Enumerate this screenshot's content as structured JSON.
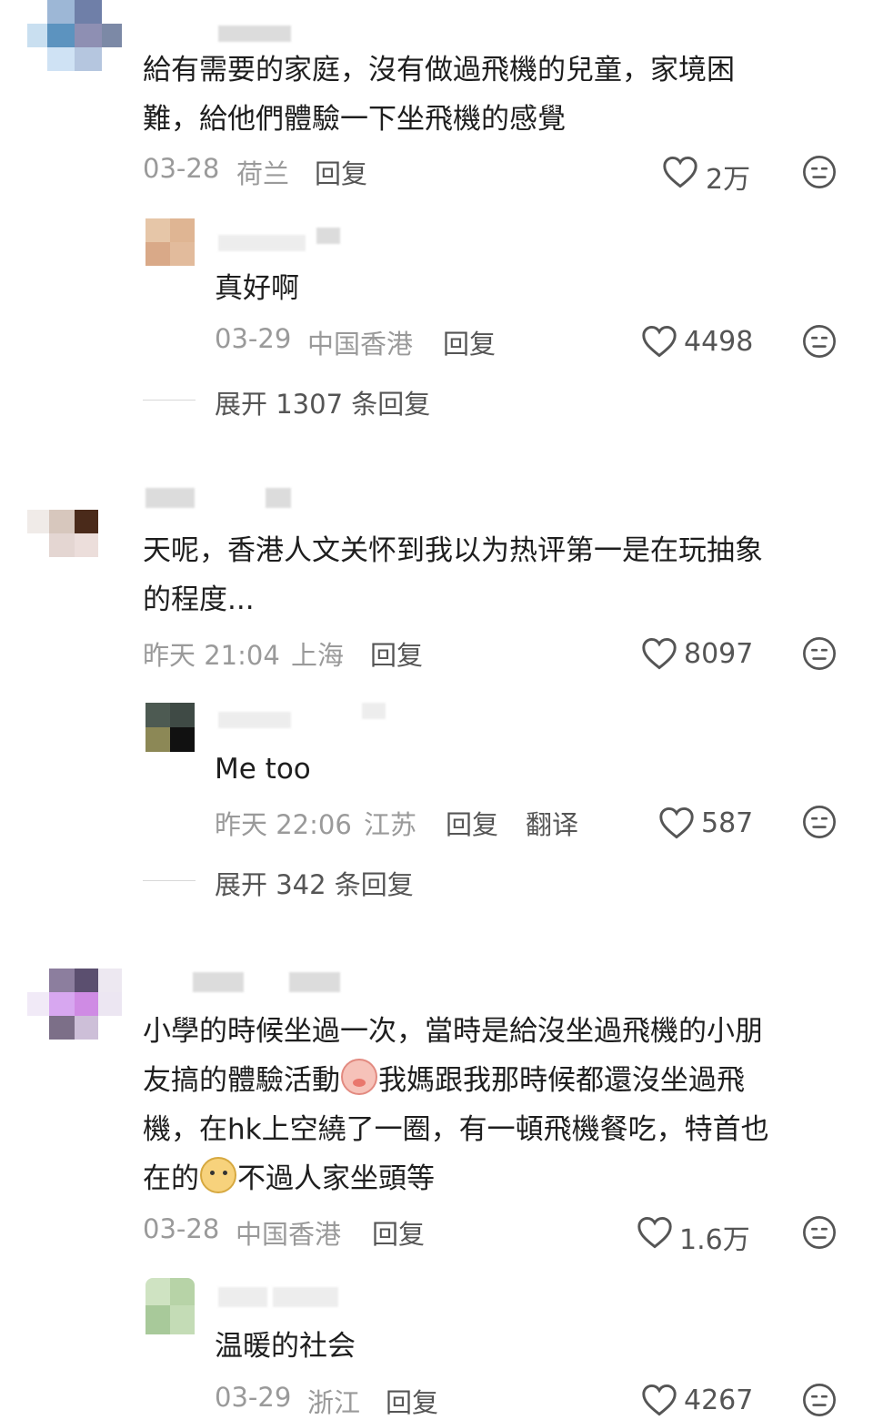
{
  "comments": [
    {
      "text_lines": [
        "給有需要的家庭，沒有做過飛機的兒童，家境困",
        "難，給他們體驗一下坐飛機的感覺"
      ],
      "date": "03-28",
      "location": "荷兰",
      "reply_label": "回复",
      "likes": "2万",
      "replies": [
        {
          "text": "真好啊",
          "date": "03-29",
          "location": "中国香港",
          "reply_label": "回复",
          "likes": "4498"
        }
      ],
      "expand_label": "展开 1307 条回复"
    },
    {
      "text_lines": [
        "天呢，香港人文关怀到我以为热评第一是在玩抽象",
        "的程度..."
      ],
      "date": "昨天 21:04",
      "location": "上海",
      "reply_label": "回复",
      "likes": "8097",
      "replies": [
        {
          "text": "Me too",
          "date": "昨天 22:06",
          "location": "江苏",
          "reply_label": "回复",
          "translate_label": "翻译",
          "likes": "587"
        }
      ],
      "expand_label": "展开 342 条回复"
    },
    {
      "text_line1": "小學的時候坐過一次，當時是給沒坐過飛機的小朋",
      "text_line2a": "友搞的體驗活動",
      "text_line2b": "我媽跟我那時候都還沒坐過飛",
      "text_line3": "機，在hk上空繞了一圈，有一頓飛機餐吃，特首也",
      "text_line4a": "在的",
      "text_line4b": "不過人家坐頭等",
      "emoji_1": "pig-face-emoji",
      "emoji_2": "dog-face-emoji",
      "date": "03-28",
      "location": "中国香港",
      "reply_label": "回复",
      "likes": "1.6万",
      "replies": [
        {
          "text": "温暖的社会",
          "date": "03-29",
          "location": "浙江",
          "reply_label": "回复",
          "likes": "4267"
        }
      ]
    }
  ],
  "colors": {
    "meta": "#9a9a9a",
    "text": "#1e1e1e",
    "action": "#555555"
  }
}
